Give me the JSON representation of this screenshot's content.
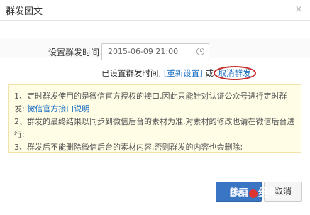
{
  "dialog": {
    "title": "群发图文",
    "close_glyph": "×"
  },
  "schedule": {
    "label": "设置群发时间",
    "datetime_value": "2015-06-09 21:00",
    "status_prefix": "已设置群发时间,",
    "reset_link": "[重新设置]",
    "or_text": "或",
    "cancel_link": "取消群发"
  },
  "notice": {
    "line1": "1、定时群发使用的是微信官方授权的接口,因此只能针对认证公众号进行定时群发;",
    "line1_link": "微信官方接口说明",
    "line2": "2、群发的最终结果以同步到微信后台的素材为准,对素材的修改也请在微信后台进行;",
    "line3": "3、群发后不能删除微信后台的素材内容,否则群发的内容也会删除;"
  },
  "footer": {
    "confirm_label": "确定",
    "cancel_label": "取消"
  },
  "watermark": {
    "text_left": "Bai",
    "text_right": "经验"
  },
  "colors": {
    "link": "#1b6ec2",
    "primary_button": "#3a75c4",
    "highlight_circle": "#c52a2a",
    "notice_bg": "#fffde6"
  }
}
